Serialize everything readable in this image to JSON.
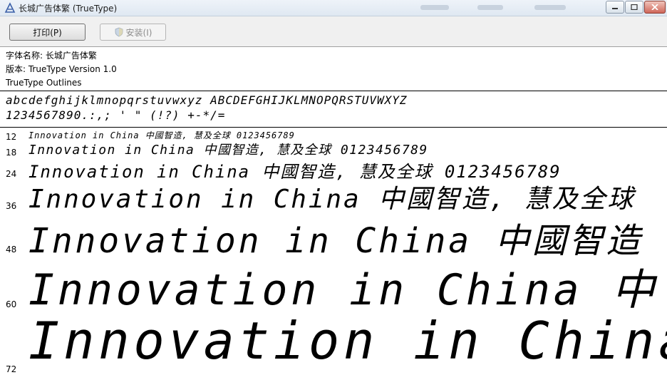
{
  "window": {
    "title": "长城广告体繁 (TrueType)",
    "controls": [
      "minimize",
      "maximize",
      "close"
    ]
  },
  "toolbar": {
    "print_label": "打印(P)",
    "install_label": "安装(I)"
  },
  "info": {
    "font_name": "字体名称: 长城广告体繁",
    "version": "版本: TrueType Version 1.0",
    "outlines": "TrueType Outlines"
  },
  "charset": {
    "line1": "abcdefghijklmnopqrstuvwxyz ABCDEFGHIJKLMNOPQRSTUVWXYZ",
    "line2": "1234567890.:,; ' \" (!?) +-*/="
  },
  "samples": [
    {
      "size": "12",
      "text": "Innovation in China 中國智造, 慧及全球 0123456789"
    },
    {
      "size": "18",
      "text": "Innovation in China 中國智造, 慧及全球 0123456789"
    },
    {
      "size": "24",
      "text": "Innovation in China 中國智造, 慧及全球 0123456789"
    },
    {
      "size": "36",
      "text": "Innovation in China 中國智造, 慧及全球"
    },
    {
      "size": "48",
      "text": "Innovation in China 中國智造"
    },
    {
      "size": "60",
      "text": "Innovation in China 中"
    },
    {
      "size": "72",
      "text": "Innovation in China"
    }
  ]
}
